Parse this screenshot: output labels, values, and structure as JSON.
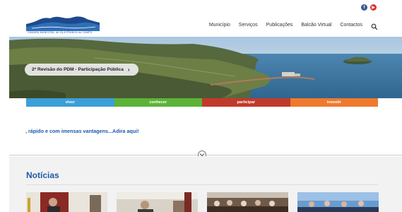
{
  "social": [
    {
      "icon": "facebook-icon",
      "glyph": "f"
    },
    {
      "icon": "youtube-icon",
      "glyph": "▶"
    }
  ],
  "logo": {
    "motto": "CÂMARA MUNICIPAL de VILA FRANCA do CAMPO"
  },
  "nav": {
    "items": [
      "Município",
      "Serviços",
      "Publicações",
      "Balcão Virtual",
      "Contactos"
    ]
  },
  "hero": {
    "button_label": "2ª Revisão do PDM - Participação Pública",
    "button_chevron": "›"
  },
  "tabs": [
    "viver",
    "conhecer",
    "participar",
    "investir"
  ],
  "promo_text": ", rápido e com imensas vantagens...Adira aqui!",
  "news": {
    "title": "Notícias"
  },
  "colors": {
    "brand_blue": "#1e5aa8",
    "viver": "#3b9fd8",
    "conhecer": "#5cb338",
    "participar": "#c03a2b",
    "investir": "#ef7a2e"
  }
}
